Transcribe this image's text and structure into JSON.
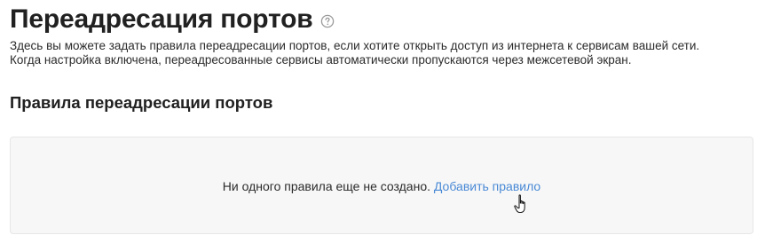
{
  "page": {
    "title": "Переадресация портов",
    "help_icon": "help-circle-icon",
    "description_line1": "Здесь вы можете задать правила переадресации портов, если хотите открыть доступ из интернета к сервисам вашей сети.",
    "description_line2": "Когда настройка включена, переадресованные сервисы автоматически пропускаются через межсетевой экран."
  },
  "rules_section": {
    "title": "Правила переадресации портов",
    "empty_text": "Ни одного правила еще не создано.",
    "add_rule_label": "Добавить правило"
  },
  "cursor": {
    "icon": "hand-pointer-icon"
  },
  "colors": {
    "link": "#4a8ad6",
    "empty_box_bg": "#f7f7f7"
  }
}
